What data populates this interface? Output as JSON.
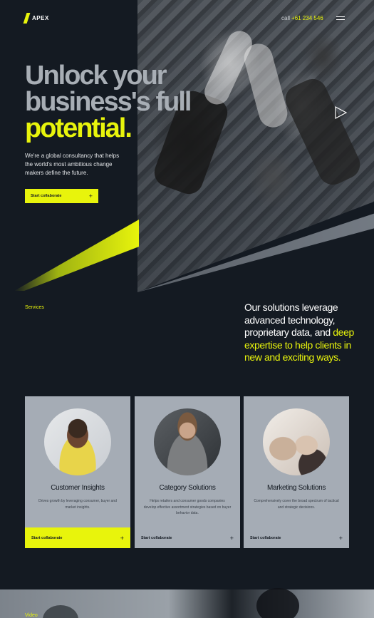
{
  "brand": {
    "name": "APEX",
    "accent": "#e8f40c",
    "background": "#141a22"
  },
  "header": {
    "call_label": "call",
    "phone": "+61 234 546",
    "menu_icon": "hamburger-icon"
  },
  "hero": {
    "title_line1": "Unlock your",
    "title_line2": "business's full",
    "title_line3": "potential.",
    "description": "We're a global consultancy that helps the world's most ambitious change makers define the future.",
    "cta_label": "Start collaborate",
    "play_icon": "play-icon"
  },
  "services": {
    "label": "Services",
    "statement_white": "Our solutions leverage advanced technology, proprietary data, and",
    "statement_yellow": "deep expertise to help clients in new and exciting ways."
  },
  "cards": [
    {
      "title": "Customer Insights",
      "description": "Drives growth by leveraging consumer, buyer and market insights.",
      "cta_label": "Start collaborate"
    },
    {
      "title": "Category Solutions",
      "description": "Helps retailers and consumer goods companies develop effective assortment strategies based on buyer behavior data.",
      "cta_label": "Start collaborate"
    },
    {
      "title": "Marketing Solutions",
      "description": "Comprehensively cover the broad spectrum of tactical and strategic decisions.",
      "cta_label": "Start collaborate"
    }
  ],
  "video": {
    "label": "Video"
  }
}
